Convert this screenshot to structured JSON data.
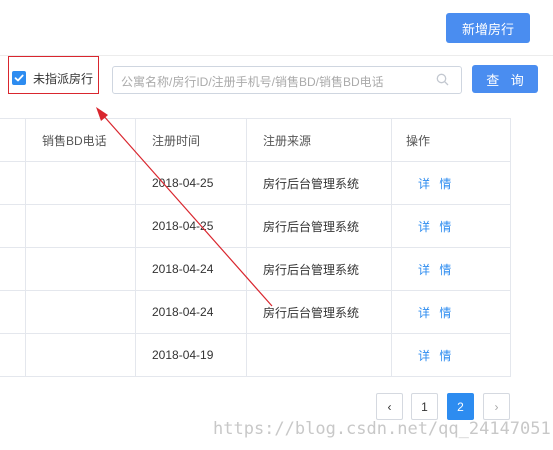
{
  "header": {
    "add_button_label": "新增房行"
  },
  "filter": {
    "unassigned_checkbox_label": "未指派房行",
    "unassigned_checked": true,
    "search_placeholder": "公寓名称/房行ID/注册手机号/销售BD/销售BD电话",
    "query_button_label": "查 询"
  },
  "table": {
    "columns": [
      "",
      "销售BD电话",
      "注册时间",
      "注册来源",
      "操作"
    ],
    "rows": [
      {
        "bd_phone": "",
        "register_time": "2018-04-25",
        "source": "房行后台管理系统",
        "action": "详 情"
      },
      {
        "bd_phone": "",
        "register_time": "2018-04-25",
        "source": "房行后台管理系统",
        "action": "详 情"
      },
      {
        "bd_phone": "",
        "register_time": "2018-04-24",
        "source": "房行后台管理系统",
        "action": "详 情"
      },
      {
        "bd_phone": "",
        "register_time": "2018-04-24",
        "source": "房行后台管理系统",
        "action": "详 情"
      },
      {
        "bd_phone": "",
        "register_time": "2018-04-19",
        "source": "",
        "action": "详 情"
      }
    ]
  },
  "pagination": {
    "prev": "‹",
    "pages": [
      "1",
      "2"
    ],
    "current_page": "2",
    "next": "›"
  },
  "watermark": "https://blog.csdn.net/qq_24147051",
  "colors": {
    "primary": "#4a8df0",
    "link": "#2d8cf0",
    "annotation": "#d9262e"
  }
}
